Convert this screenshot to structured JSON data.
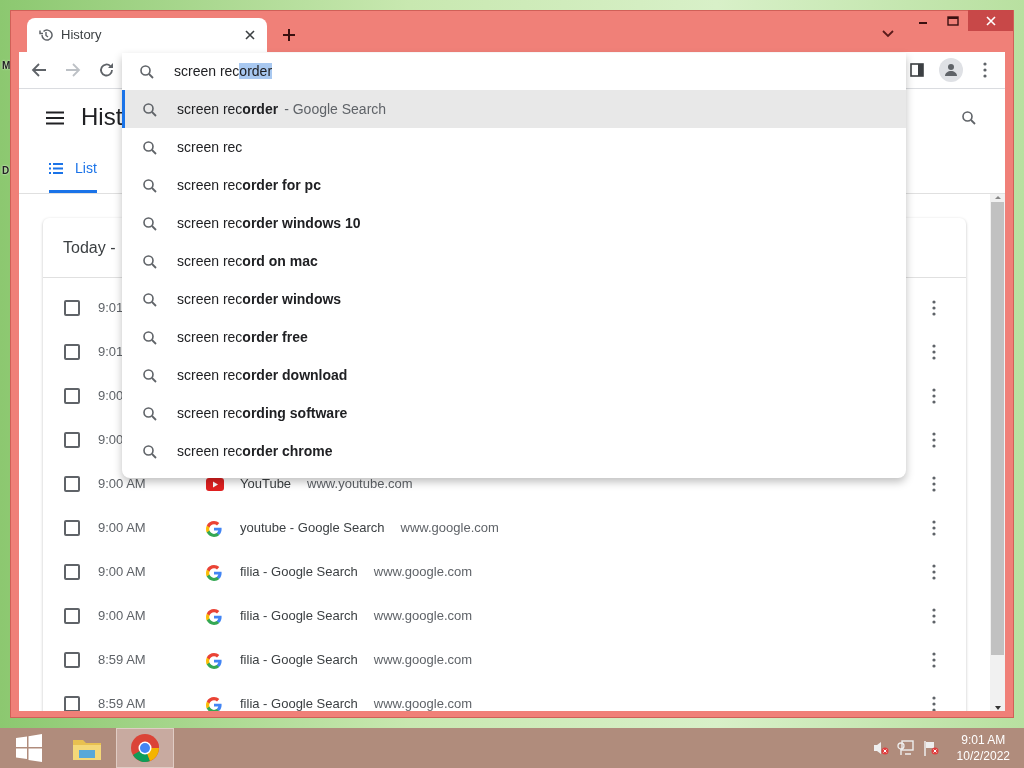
{
  "desktop": {
    "labels": [
      "M",
      "D"
    ]
  },
  "window": {
    "tab": {
      "title": "History",
      "selected": true
    }
  },
  "omnibox": {
    "typed": "screen rec",
    "completion": "order"
  },
  "suggestions": [
    {
      "text": "screen rec**order**",
      "hint": "- Google Search",
      "selected": true
    },
    {
      "text": "screen rec",
      "selected": false
    },
    {
      "text": "screen rec**order for pc**",
      "selected": false
    },
    {
      "text": "screen rec**order windows 10**",
      "selected": false
    },
    {
      "text": "screen rec**ord on mac**",
      "selected": false
    },
    {
      "text": "screen rec**order windows**",
      "selected": false
    },
    {
      "text": "screen rec**order free**",
      "selected": false
    },
    {
      "text": "screen rec**order download**",
      "selected": false
    },
    {
      "text": "screen rec**ording software**",
      "selected": false
    },
    {
      "text": "screen rec**order chrome**",
      "selected": false
    }
  ],
  "page": {
    "title": "Hist",
    "tabs": [
      {
        "label": "List",
        "selected": true
      }
    ],
    "card_title": "Today -"
  },
  "rows": [
    {
      "time": "9:01",
      "checked": false
    },
    {
      "time": "9:01",
      "checked": false
    },
    {
      "time": "9:00",
      "checked": false
    },
    {
      "time": "9:00",
      "checked": false
    },
    {
      "time": "9:00 AM",
      "kind": "youtube",
      "title": "YouTube",
      "url": "www.youtube.com",
      "checked": false
    },
    {
      "time": "9:00 AM",
      "kind": "google",
      "title": "youtube - Google Search",
      "url": "www.google.com",
      "checked": false
    },
    {
      "time": "9:00 AM",
      "kind": "google",
      "title": "filia - Google Search",
      "url": "www.google.com",
      "checked": false
    },
    {
      "time": "9:00 AM",
      "kind": "google",
      "title": "filia - Google Search",
      "url": "www.google.com",
      "checked": false
    },
    {
      "time": "8:59 AM",
      "kind": "google",
      "title": "filia - Google Search",
      "url": "www.google.com",
      "checked": false
    },
    {
      "time": "8:59 AM",
      "kind": "google",
      "title": "filia - Google Search",
      "url": "www.google.com",
      "checked": false
    }
  ],
  "taskbar": {
    "apps": [
      {
        "kind": "folder",
        "selected": false
      },
      {
        "kind": "chrome",
        "selected": true
      }
    ],
    "time": "9:01 AM",
    "date": "10/2/2022"
  }
}
